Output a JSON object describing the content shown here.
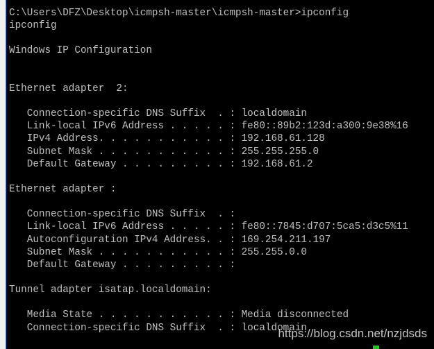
{
  "terminal": {
    "lines": [
      "C:\\Users\\DFZ\\Desktop\\icmpsh-master\\icmpsh-master>ipconfig",
      "ipconfig",
      "",
      "Windows IP Configuration",
      "",
      "",
      "Ethernet adapter  2:",
      "",
      "   Connection-specific DNS Suffix  . : localdomain",
      "   Link-local IPv6 Address . . . . . : fe80::89b2:123d:a300:9e38%16",
      "   IPv4 Address. . . . . . . . . . . : 192.168.61.128",
      "   Subnet Mask . . . . . . . . . . . : 255.255.255.0",
      "   Default Gateway . . . . . . . . . : 192.168.61.2",
      "",
      "Ethernet adapter :",
      "",
      "   Connection-specific DNS Suffix  . :",
      "   Link-local IPv6 Address . . . . . : fe80::7845:d707:5ca5:d3c5%11",
      "   Autoconfiguration IPv4 Address. . : 169.254.211.197",
      "   Subnet Mask . . . . . . . . . . . : 255.255.0.0",
      "   Default Gateway . . . . . . . . . :",
      "",
      "Tunnel adapter isatap.localdomain:",
      "",
      "   Media State . . . . . . . . . . . : Media disconnected",
      "   Connection-specific DNS Suffix  . : localdomain"
    ]
  },
  "watermark": "https://blog.csdn.net/nzjdsds",
  "colors": {
    "background": "#000000",
    "text": "#c0c0c0",
    "cursor": "#22c322"
  }
}
